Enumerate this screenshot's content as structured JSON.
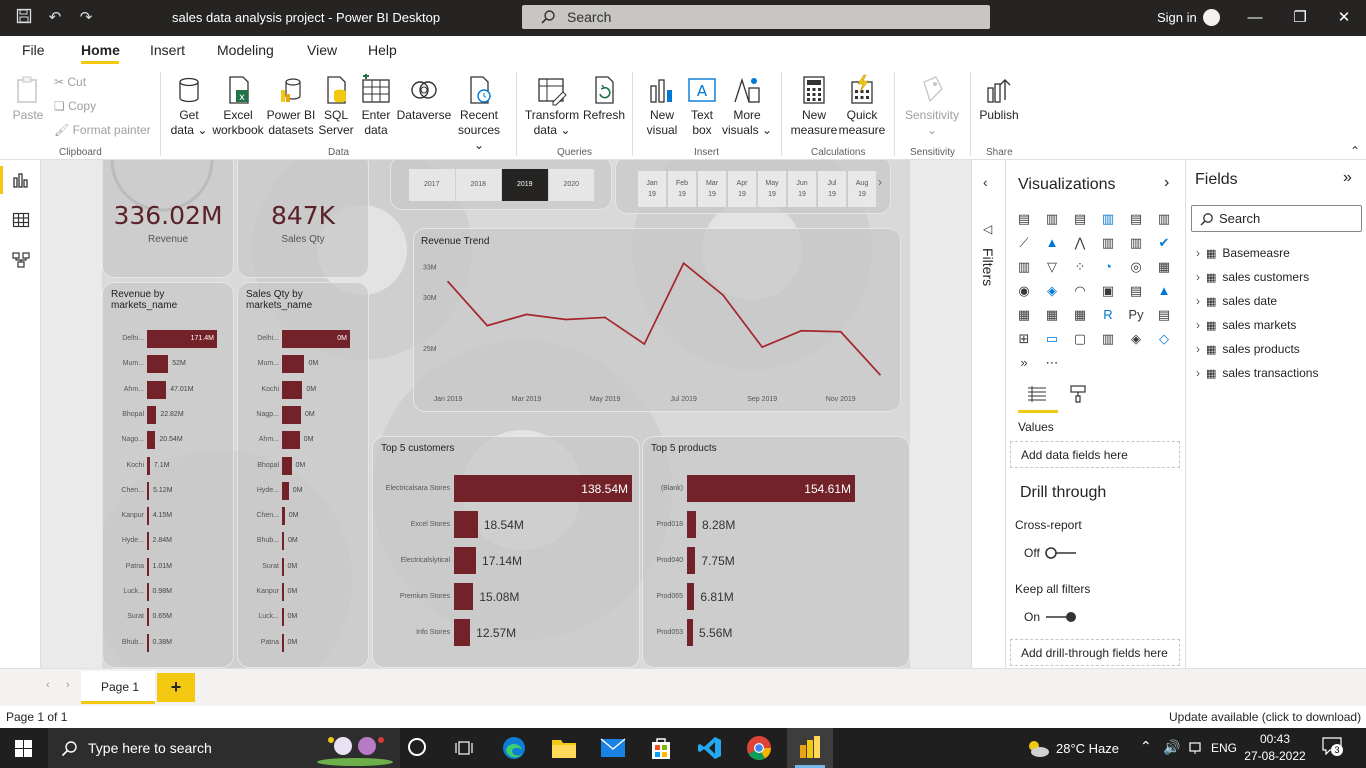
{
  "titlebar": {
    "title": "sales data analysis project - Power BI Desktop",
    "search_placeholder": "Search",
    "signin": "Sign in"
  },
  "menu": [
    "File",
    "Home",
    "Insert",
    "Modeling",
    "View",
    "Help"
  ],
  "ribbon": {
    "clipboard": {
      "paste": "Paste",
      "cut": "Cut",
      "copy": "Copy",
      "format_painter": "Format painter",
      "group": "Clipboard"
    },
    "data": {
      "get_data": [
        "Get",
        "data"
      ],
      "excel": [
        "Excel",
        "workbook"
      ],
      "powerbi": [
        "Power BI",
        "datasets"
      ],
      "sql": [
        "SQL",
        "Server"
      ],
      "enter": [
        "Enter",
        "data"
      ],
      "dataverse": "Dataverse",
      "recent": [
        "Recent",
        "sources"
      ],
      "group": "Data"
    },
    "queries": {
      "transform": [
        "Transform",
        "data"
      ],
      "refresh": "Refresh",
      "group": "Queries"
    },
    "insert": {
      "new_visual": [
        "New",
        "visual"
      ],
      "text_box": [
        "Text",
        "box"
      ],
      "more_visuals": [
        "More",
        "visuals"
      ],
      "group": "Insert"
    },
    "calculations": {
      "new_measure": [
        "New",
        "measure"
      ],
      "quick_measure": [
        "Quick",
        "measure"
      ],
      "group": "Calculations"
    },
    "sensitivity": {
      "label": "Sensitivity",
      "group": "Sensitivity"
    },
    "share": {
      "publish": "Publish",
      "group": "Share"
    }
  },
  "dashboard": {
    "kpi_revenue": {
      "value": "336.02M",
      "label": "Revenue"
    },
    "kpi_qty": {
      "value": "847K",
      "label": "Sales Qty"
    },
    "years": [
      "2017",
      "2018",
      "2019",
      "2020"
    ],
    "selected_year": "2019",
    "months": [
      [
        "Jan",
        "19"
      ],
      [
        "Feb",
        "19"
      ],
      [
        "Mar",
        "19"
      ],
      [
        "Apr",
        "19"
      ],
      [
        "May",
        "19"
      ],
      [
        "Jun",
        "19"
      ],
      [
        "Jul",
        "19"
      ],
      [
        "Aug",
        "19"
      ]
    ],
    "revenue_by_market": {
      "title": [
        "Revenue by",
        "markets_name"
      ],
      "items": [
        {
          "label": "Delhi...",
          "value": 171.4,
          "text": "171.4M"
        },
        {
          "label": "Mum...",
          "value": 52,
          "text": "52M"
        },
        {
          "label": "Ahm...",
          "value": 47.01,
          "text": "47.01M"
        },
        {
          "label": "Bhopal",
          "value": 22.82,
          "text": "22.82M"
        },
        {
          "label": "Nago...",
          "value": 20.54,
          "text": "20.54M"
        },
        {
          "label": "Kochi",
          "value": 7.1,
          "text": "7.1M"
        },
        {
          "label": "Chen...",
          "value": 5.12,
          "text": "5.12M"
        },
        {
          "label": "Kanpur",
          "value": 4.15,
          "text": "4.15M"
        },
        {
          "label": "Hyde...",
          "value": 2.84,
          "text": "2.84M"
        },
        {
          "label": "Patna",
          "value": 1.01,
          "text": "1.01M"
        },
        {
          "label": "Luck...",
          "value": 0.98,
          "text": "0.98M"
        },
        {
          "label": "Surat",
          "value": 0.65,
          "text": "0.65M"
        },
        {
          "label": "Bhub...",
          "value": 0.38,
          "text": "0.38M"
        }
      ]
    },
    "qty_by_market": {
      "title": [
        "Sales Qty by",
        "markets_name"
      ],
      "items": [
        {
          "label": "Delhi...",
          "value": 100,
          "text": "0M"
        },
        {
          "label": "Mum...",
          "value": 33,
          "text": "0M"
        },
        {
          "label": "Kochi",
          "value": 30,
          "text": "0M"
        },
        {
          "label": "Nagp...",
          "value": 28,
          "text": "0M"
        },
        {
          "label": "Ahm...",
          "value": 26,
          "text": "0M"
        },
        {
          "label": "Bhopal",
          "value": 14,
          "text": "0M"
        },
        {
          "label": "Hyde...",
          "value": 10,
          "text": "0M"
        },
        {
          "label": "Chen...",
          "value": 4,
          "text": "0M"
        },
        {
          "label": "Bhub...",
          "value": 3,
          "text": "0M"
        },
        {
          "label": "Surat",
          "value": 2,
          "text": "0M"
        },
        {
          "label": "Kanpur",
          "value": 2,
          "text": "0M"
        },
        {
          "label": "Luck...",
          "value": 2,
          "text": "0M"
        },
        {
          "label": "Patna",
          "value": 1,
          "text": "0M"
        }
      ]
    },
    "top_customers": {
      "title": "Top 5 customers",
      "items": [
        {
          "label": "Electricalsara Stores",
          "value": 138.54,
          "text": "138.54M"
        },
        {
          "label": "Excel Stores",
          "value": 18.54,
          "text": "18.54M"
        },
        {
          "label": "Electricalslytical",
          "value": 17.14,
          "text": "17.14M"
        },
        {
          "label": "Premium Stores",
          "value": 15.08,
          "text": "15.08M"
        },
        {
          "label": "Info Stores",
          "value": 12.57,
          "text": "12.57M"
        }
      ]
    },
    "top_products": {
      "title": "Top 5 products",
      "items": [
        {
          "label": "(Blank)",
          "value": 154.61,
          "text": "154.61M"
        },
        {
          "label": "Prod018",
          "value": 8.28,
          "text": "8.28M"
        },
        {
          "label": "Prod040",
          "value": 7.75,
          "text": "7.75M"
        },
        {
          "label": "Prod065",
          "value": 6.81,
          "text": "6.81M"
        },
        {
          "label": "Prod053",
          "value": 5.56,
          "text": "5.56M"
        }
      ]
    }
  },
  "chart_data": {
    "type": "line",
    "title": "Revenue Trend",
    "x": [
      "Jan 2019",
      "Feb 2019",
      "Mar 2019",
      "Apr 2019",
      "May 2019",
      "Jun 2019",
      "Jul 2019",
      "Aug 2019",
      "Sep 2019",
      "Oct 2019",
      "Nov 2019",
      "Dec 2019"
    ],
    "x_ticks": [
      "Jan 2019",
      "Mar 2019",
      "May 2019",
      "Jul 2019",
      "Sep 2019",
      "Nov 2019"
    ],
    "values": [
      31.5,
      27.2,
      28.3,
      27.8,
      28.0,
      25.4,
      33.3,
      30.2,
      25.1,
      26.7,
      26.6,
      22.4
    ],
    "y_ticks": [
      "33M",
      "30M",
      "25M"
    ],
    "ylim": [
      21,
      34.5
    ],
    "color": "#a4262c",
    "grid": false
  },
  "filters": {
    "label": "Filters"
  },
  "visualizations": {
    "title": "Visualizations",
    "values_label": "Values",
    "values_well": "Add data fields here",
    "drill_title": "Drill through",
    "cross_report": "Cross-report",
    "cross_state": "Off",
    "keep_filters": "Keep all filters",
    "keep_state": "On",
    "drill_well": "Add drill-through fields here"
  },
  "fields": {
    "title": "Fields",
    "search_placeholder": "Search",
    "tables": [
      "Basemeasre",
      "sales customers",
      "sales date",
      "sales markets",
      "sales products",
      "sales transactions"
    ]
  },
  "pages": {
    "tab": "Page 1",
    "add": "+"
  },
  "status": {
    "page": "Page 1 of 1",
    "update": "Update available (click to download)"
  },
  "taskbar": {
    "search": "Type here to search",
    "weather": "28°C  Haze",
    "lang": "ENG",
    "time": "00:43",
    "date": "27-08-2022",
    "notif": "3"
  }
}
